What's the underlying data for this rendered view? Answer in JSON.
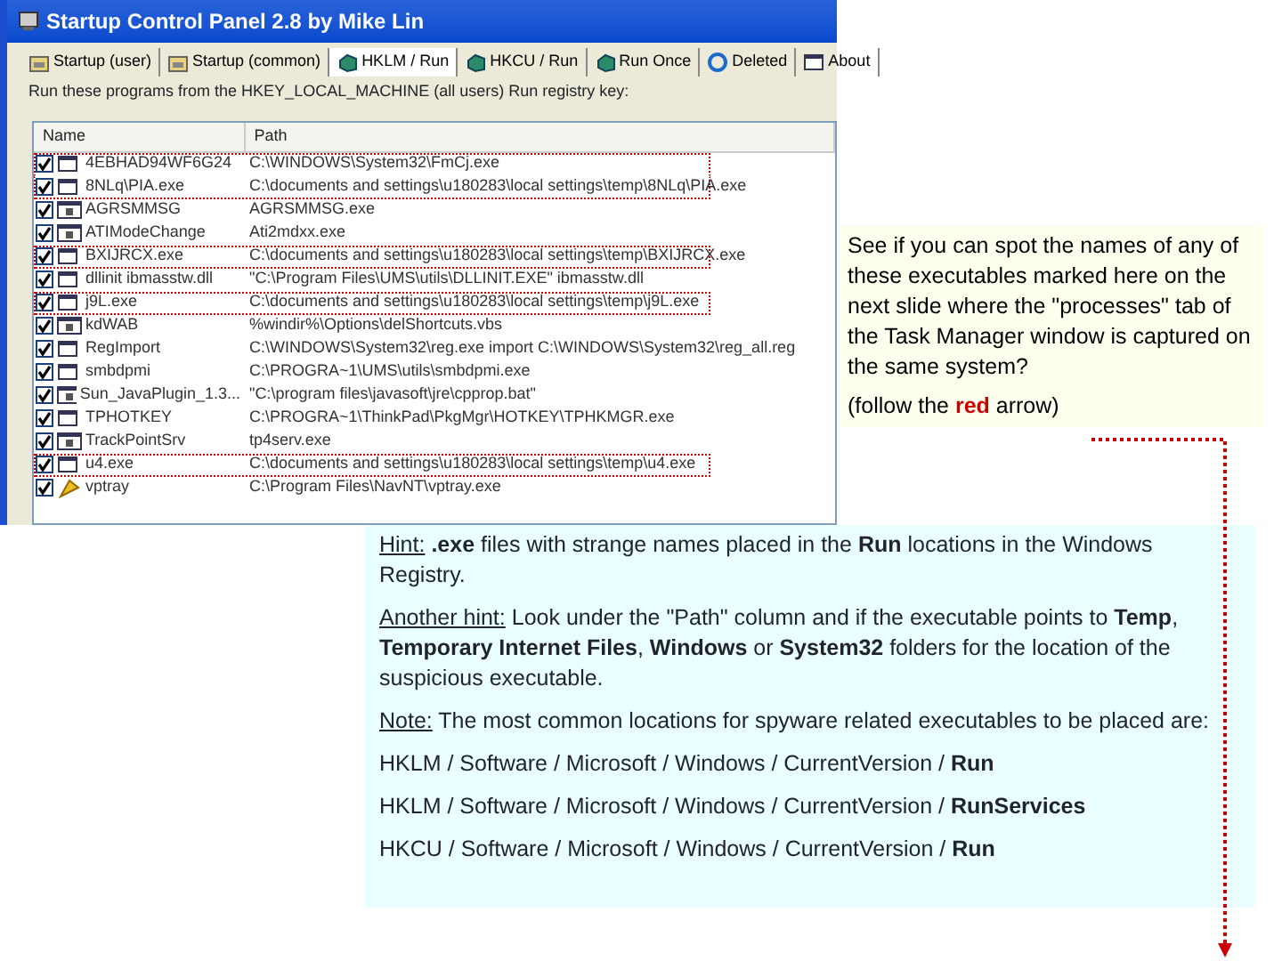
{
  "window": {
    "title": "Startup Control Panel 2.8 by Mike Lin"
  },
  "tabs": [
    {
      "label": "Startup (user)",
      "kind": "folder",
      "selected": false
    },
    {
      "label": "Startup (common)",
      "kind": "folder",
      "selected": false
    },
    {
      "label": "HKLM / Run",
      "kind": "cube",
      "selected": true
    },
    {
      "label": "HKCU / Run",
      "kind": "cube",
      "selected": false
    },
    {
      "label": "Run Once",
      "kind": "cube",
      "selected": false
    },
    {
      "label": "Deleted",
      "kind": "recycle",
      "selected": false
    },
    {
      "label": "About",
      "kind": "window",
      "selected": false
    }
  ],
  "description": "Run these programs from the HKEY_LOCAL_MACHINE (all users) Run registry key:",
  "table": {
    "columns": [
      "Name",
      "Path"
    ],
    "rows": [
      {
        "name": "4EBHAD94WF6G24",
        "path": "C:\\WINDOWS\\System32\\FmCj.exe",
        "kind": "window",
        "checked": true,
        "marked": true
      },
      {
        "name": "8NLq\\PIA.exe",
        "path": "C:\\documents and settings\\u180283\\local settings\\temp\\8NLq\\PIA.exe",
        "kind": "window",
        "checked": true,
        "marked": true
      },
      {
        "name": "AGRSMMSG",
        "path": "AGRSMMSG.exe",
        "kind": "setup",
        "checked": true,
        "marked": false
      },
      {
        "name": "ATIModeChange",
        "path": "Ati2mdxx.exe",
        "kind": "setup",
        "checked": true,
        "marked": false
      },
      {
        "name": "BXIJRCX.exe",
        "path": "C:\\documents and settings\\u180283\\local settings\\temp\\BXIJRCX.exe",
        "kind": "window",
        "checked": true,
        "marked": true
      },
      {
        "name": "dllinit ibmasstw.dll",
        "path": "\"C:\\Program Files\\UMS\\utils\\DLLINIT.EXE\" ibmasstw.dll",
        "kind": "window",
        "checked": true,
        "marked": false
      },
      {
        "name": "j9L.exe",
        "path": "C:\\documents and settings\\u180283\\local settings\\temp\\j9L.exe",
        "kind": "window",
        "checked": true,
        "marked": true
      },
      {
        "name": "kdWAB",
        "path": "%windir%\\Options\\delShortcuts.vbs",
        "kind": "setup",
        "checked": true,
        "marked": false
      },
      {
        "name": "RegImport",
        "path": "C:\\WINDOWS\\System32\\reg.exe import C:\\WINDOWS\\System32\\reg_all.reg",
        "kind": "window",
        "checked": true,
        "marked": false
      },
      {
        "name": "smbdpmi",
        "path": "C:\\PROGRA~1\\UMS\\utils\\smbdpmi.exe",
        "kind": "window",
        "checked": true,
        "marked": false
      },
      {
        "name": "Sun_JavaPlugin_1.3...",
        "path": "\"C:\\program files\\javasoft\\jre\\cpprop.bat\"",
        "kind": "setup",
        "checked": true,
        "marked": false
      },
      {
        "name": "TPHOTKEY",
        "path": "C:\\PROGRA~1\\ThinkPad\\PkgMgr\\HOTKEY\\TPHKMGR.exe",
        "kind": "window",
        "checked": true,
        "marked": false
      },
      {
        "name": "TrackPointSrv",
        "path": "tp4serv.exe",
        "kind": "setup",
        "checked": true,
        "marked": false
      },
      {
        "name": "u4.exe",
        "path": "C:\\documents and settings\\u180283\\local settings\\temp\\u4.exe",
        "kind": "window",
        "checked": true,
        "marked": true
      },
      {
        "name": "vptray",
        "path": "C:\\Program Files\\NavNT\\vptray.exe",
        "kind": "shield",
        "checked": true,
        "marked": false
      }
    ]
  },
  "note": {
    "text": "See if you can spot the names of any of these executables marked here on the next slide where the \"processes\" tab of the Task Manager window is captured on the same system?",
    "follow": "(follow the **red** arrow)"
  },
  "hints": [
    {
      "label": "Hint:",
      "text": " **.exe** files with strange names placed in the **Run** locations in the Windows Registry."
    },
    {
      "label": "Another hint:",
      "text": " Look under the \"Path\" column and if the executable points to **Temp**, **Temporary Internet Files**, **Windows** or **System32** folders for the location of the suspicious executable."
    },
    {
      "label": "Note:",
      "text": " The most common locations for spyware related executables to be placed are:"
    }
  ],
  "locations": [
    "HKLM / Software / Microsoft / Windows / CurrentVersion / **Run**",
    "HKLM / Software / Microsoft / Windows / CurrentVersion / **RunServices**",
    "HKCU / Software / Microsoft / Windows / CurrentVersion / **Run**"
  ]
}
